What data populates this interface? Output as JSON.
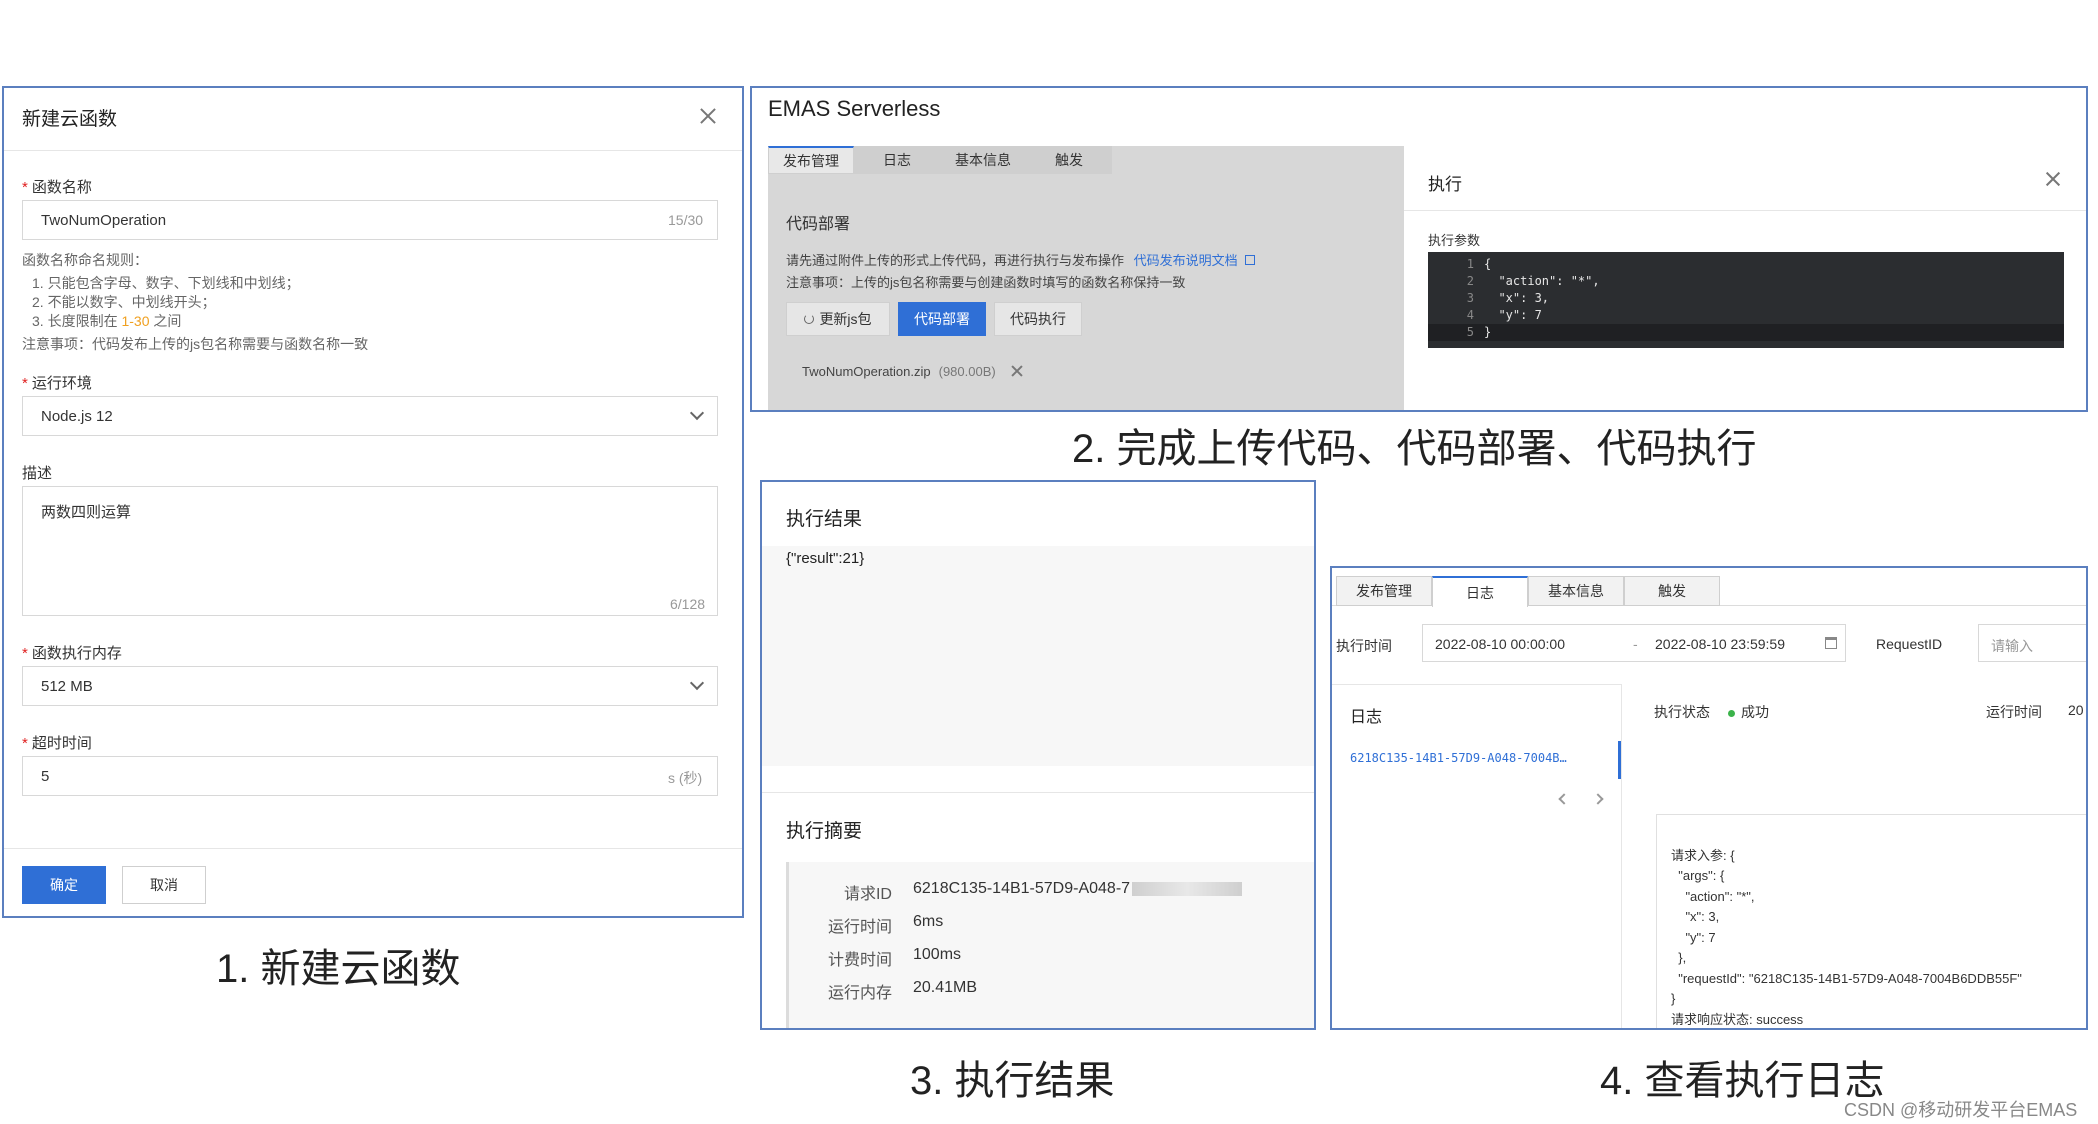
{
  "captions": {
    "p1": "1. 新建云函数",
    "p2": "2. 完成上传代码、代码部署、代码执行",
    "p3": "3. 执行结果",
    "p4": "4. 查看执行日志"
  },
  "watermark": "CSDN @移动研发平台EMAS",
  "panel1": {
    "title": "新建云函数",
    "fn_name_label": "函数名称",
    "fn_name_value": "TwoNumOperation",
    "fn_name_count": "15/30",
    "rules_title": "函数名称命名规则：",
    "rule1": "1. 只能包含字母、数字、下划线和中划线；",
    "rule2": "2. 不能以数字、中划线开头；",
    "rule3_pre": "3. 长度限制在 ",
    "rule3_hl": "1-30",
    "rule3_post": " 之间",
    "notice": "注意事项：代码发布上传的js包名称需要与函数名称一致",
    "runtime_label": "运行环境",
    "runtime_value": "Node.js 12",
    "desc_label": "描述",
    "desc_value": "两数四则运算",
    "desc_count": "6/128",
    "memory_label": "函数执行内存",
    "memory_value": "512 MB",
    "timeout_label": "超时时间",
    "timeout_value": "5",
    "timeout_unit": "s (秒)",
    "ok": "确定",
    "cancel": "取消"
  },
  "panel2": {
    "app_title": "EMAS Serverless",
    "tabs": [
      "发布管理",
      "日志",
      "基本信息",
      "触发"
    ],
    "section": "代码部署",
    "line1": "请先通过附件上传的形式上传代码，再进行执行与发布操作",
    "doc_link": "代码发布说明文档",
    "line2": "注意事项：上传的js包名称需要与创建函数时填写的函数名称保持一致",
    "btn_update": "更新js包",
    "btn_deploy": "代码部署",
    "btn_run": "代码执行",
    "file_name": "TwoNumOperation.zip",
    "file_size": "(980.00B)",
    "drawer_title": "执行",
    "params_label": "执行参数",
    "code": [
      {
        "n": "1",
        "t": "{"
      },
      {
        "n": "2",
        "t": "  \"action\": \"*\","
      },
      {
        "n": "3",
        "t": "  \"x\": 3,"
      },
      {
        "n": "4",
        "t": "  \"y\": 7"
      },
      {
        "n": "5",
        "t": "}"
      }
    ]
  },
  "panel3": {
    "result_title": "执行结果",
    "result_value": "{\"result\":21}",
    "summary_title": "执行摘要",
    "rows": [
      {
        "k": "请求ID",
        "v": "6218C135-14B1-57D9-A048-7"
      },
      {
        "k": "运行时间",
        "v": "6ms"
      },
      {
        "k": "计费时间",
        "v": "100ms"
      },
      {
        "k": "运行内存",
        "v": "20.41MB"
      }
    ]
  },
  "panel4": {
    "tabs": [
      "发布管理",
      "日志",
      "基本信息",
      "触发"
    ],
    "time_label": "执行时间",
    "start": "2022-08-10 00:00:00",
    "sep": "-",
    "end": "2022-08-10 23:59:59",
    "reqid_label": "RequestID",
    "reqid_placeholder": "请输入",
    "log_title": "日志",
    "log_item": "6218C135-14B1-57D9-A048-7004B…",
    "status_label": "执行状态",
    "status_value": "成功",
    "runtime_label": "运行时间",
    "runtime_value": "20",
    "json_lines": [
      "请求入参: {",
      "  \"args\": {",
      "    \"action\": \"*\",",
      "    \"x\": 3,",
      "    \"y\": 7",
      "  },",
      "  \"requestId\": \"6218C135-14B1-57D9-A048-7004B6DDB55F\"",
      "}",
      "请求响应状态: success"
    ]
  },
  "colors": {
    "accent": "#2f6fd6",
    "border": "#5b7fbf",
    "success": "#3bb34a",
    "highlight": "#f0a020"
  }
}
